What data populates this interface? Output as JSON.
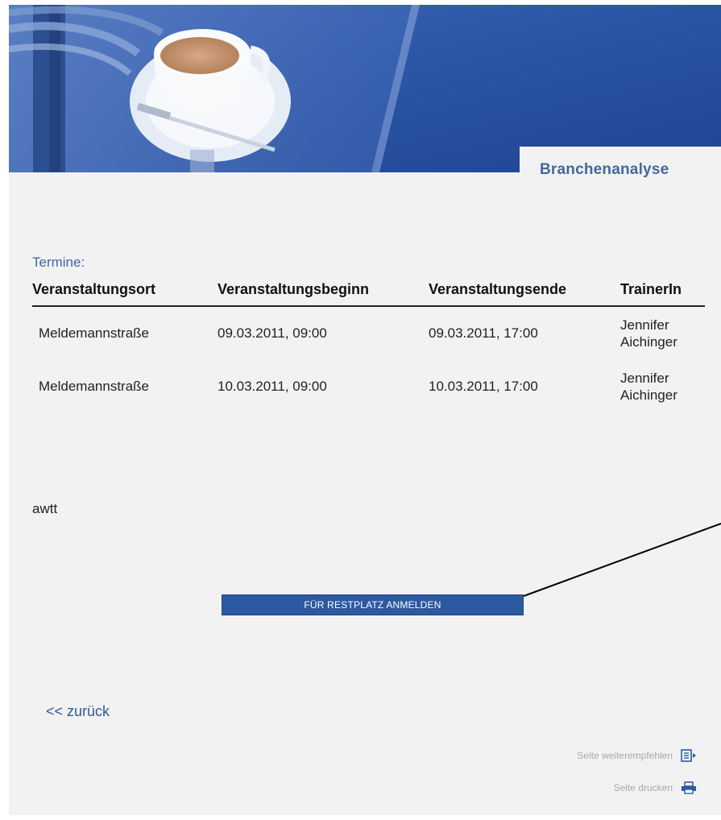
{
  "header": {
    "section_title": "Branchenanalyse"
  },
  "termine": {
    "label": "Termine:",
    "columns": [
      "Veranstaltungsort",
      "Veranstaltungsbeginn",
      "Veranstaltungsende",
      "TrainerIn"
    ],
    "rows": [
      {
        "ort": "Meldemannstraße",
        "beginn": "09.03.2011, 09:00",
        "ende": "09.03.2011, 17:00",
        "trainer_first": "Jennifer",
        "trainer_last": "Aichinger"
      },
      {
        "ort": "Meldemannstraße",
        "beginn": "10.03.2011, 09:00",
        "ende": "10.03.2011, 17:00",
        "trainer_first": "Jennifer",
        "trainer_last": "Aichinger"
      }
    ]
  },
  "note": "awtt",
  "register_button": {
    "label": "FÜR RESTPLATZ ANMELDEN"
  },
  "back_link": "<< zurück",
  "footer": {
    "recommend_label": "Seite weiterempfehlen",
    "print_label": "Seite drucken"
  },
  "colors": {
    "accent": "#43689e",
    "button": "#2b5aa0",
    "background": "#f2f2f2"
  }
}
